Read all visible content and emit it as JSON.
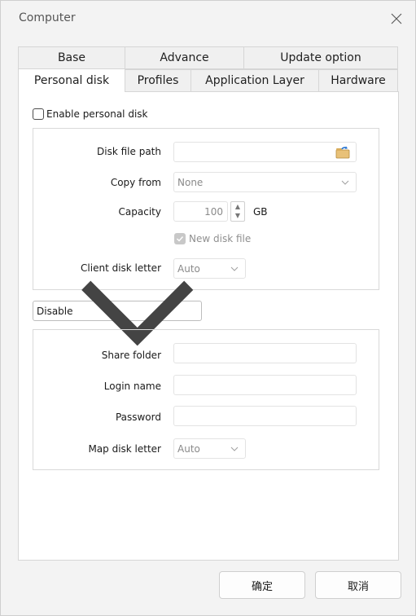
{
  "window": {
    "title": "Computer"
  },
  "tabs": {
    "row1": [
      "Base",
      "Advance",
      "Update option"
    ],
    "row2": [
      "Personal disk",
      "Profiles",
      "Application Layer",
      "Hardware"
    ],
    "active": "Personal disk"
  },
  "personal_disk": {
    "enable_label": "Enable personal disk",
    "enable_checked": false,
    "disk_file_path": {
      "label": "Disk file path",
      "value": ""
    },
    "copy_from": {
      "label": "Copy from",
      "value": "None"
    },
    "capacity": {
      "label": "Capacity",
      "value": "100",
      "unit": "GB"
    },
    "new_disk_file": {
      "label": "New disk file",
      "checked": true
    },
    "client_disk_letter": {
      "label": "Client disk letter",
      "value": "Auto"
    }
  },
  "share": {
    "mode": "Disable",
    "share_folder": {
      "label": "Share folder",
      "value": ""
    },
    "login_name": {
      "label": "Login name",
      "value": ""
    },
    "password": {
      "label": "Password",
      "value": ""
    },
    "map_disk_letter": {
      "label": "Map disk letter",
      "value": "Auto"
    }
  },
  "buttons": {
    "ok": "确定",
    "cancel": "取消"
  }
}
